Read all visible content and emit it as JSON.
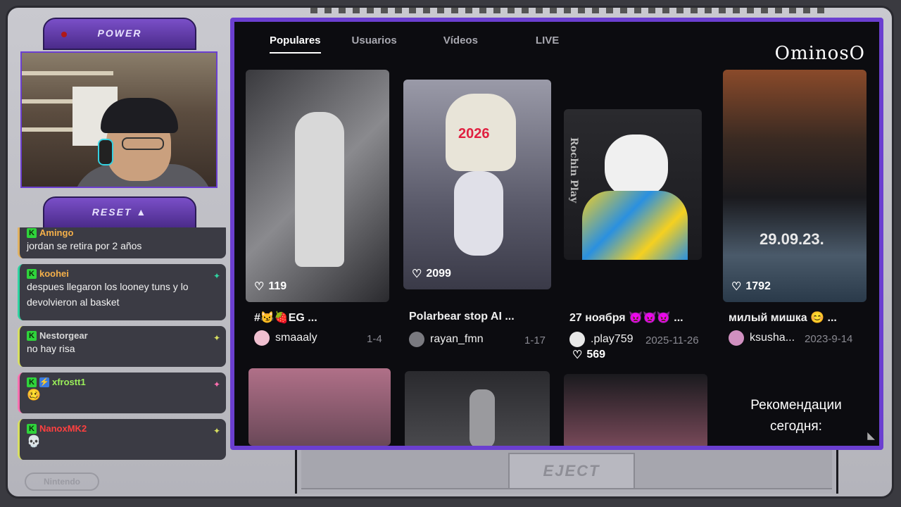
{
  "console": {
    "power_label": "POWER",
    "reset_label": "RESET ▲",
    "eject_label": "EJECT",
    "logo_label": "Nintendo"
  },
  "chat": {
    "messages": [
      {
        "user": "Amingo",
        "text": "jordan se retira por 2 años",
        "accent": "#e0b060",
        "name_color": "#f5b04a"
      },
      {
        "user": "koohei",
        "text": "despues llegaron los looney tuns y lo devolvieron al basket",
        "accent": "#2fd3a0",
        "name_color": "#f5b04a"
      },
      {
        "user": "Nestorgear",
        "text": "no hay risa",
        "accent": "#d8e060",
        "name_color": "#d8d8d8"
      },
      {
        "user": "xfrostt1",
        "text": "",
        "accent": "#ff6fb0",
        "name_color": "#9bf05a"
      },
      {
        "user": "NanoxMK2",
        "text": "",
        "accent": "#d8e060",
        "name_color": "#ff4040"
      }
    ]
  },
  "screen": {
    "brand": "OminosO",
    "tabs": [
      {
        "label": "Populares",
        "active": true
      },
      {
        "label": "Usuarios",
        "active": false
      },
      {
        "label": "Vídeos",
        "active": false
      },
      {
        "label": "LIVE",
        "active": false
      }
    ],
    "cards": [
      {
        "likes": "119",
        "caption": "#😼🍓EG ...",
        "author": "smaaaly",
        "date": "1-4",
        "avatar_color": "#f0c0d0",
        "thumb_text": ""
      },
      {
        "likes": "2099",
        "caption": "Polarbear stop AI ...",
        "author": "rayan_fmn",
        "date": "1-17",
        "avatar_color": "#7a7a80",
        "thumb_text": "2026"
      },
      {
        "likes": "569",
        "caption": "27 ноября 👿👿👿 ...",
        "author": ".play759",
        "date": "2025-11-26",
        "avatar_color": "#e8e8e8",
        "thumb_text": "Rochin Play"
      },
      {
        "likes": "1792",
        "caption": "милый мишка 😊 ...",
        "author": "ksusha...",
        "date": "2023-9-14",
        "avatar_color": "#d090c0",
        "thumb_text": "29.09.23."
      }
    ],
    "recommendation": "Рекомендации сегодня:"
  }
}
